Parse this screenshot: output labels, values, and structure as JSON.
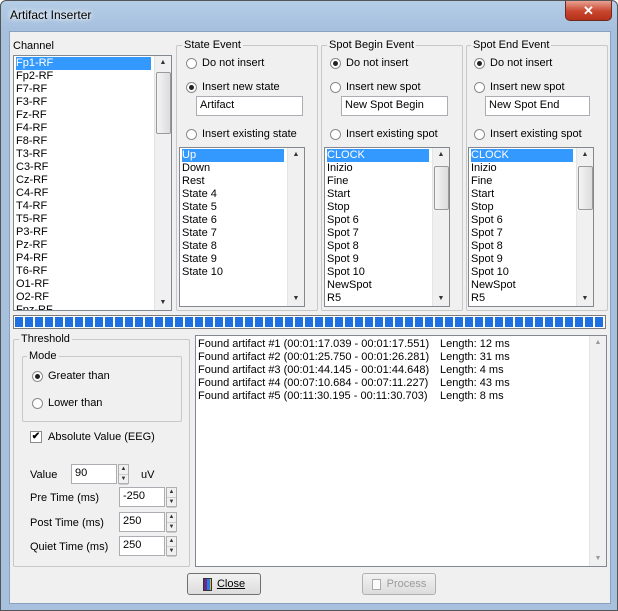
{
  "window": {
    "title": "Artifact Inserter",
    "close_glyph": "✕"
  },
  "channel": {
    "label": "Channel",
    "items": [
      "Fp1-RF",
      "Fp2-RF",
      "F7-RF",
      "F3-RF",
      "Fz-RF",
      "F4-RF",
      "F8-RF",
      "T3-RF",
      "C3-RF",
      "Cz-RF",
      "C4-RF",
      "T4-RF",
      "T5-RF",
      "P3-RF",
      "Pz-RF",
      "P4-RF",
      "T6-RF",
      "O1-RF",
      "O2-RF",
      "Fpz-RF"
    ],
    "selected": "Fp1-RF"
  },
  "state_event": {
    "label": "State Event",
    "do_not_insert": "Do not insert",
    "insert_new": "Insert new state",
    "new_value": "Artifact",
    "insert_existing": "Insert existing state",
    "items": [
      "Up",
      "Down",
      "Rest",
      "State 4",
      "State 5",
      "State 6",
      "State 7",
      "State 8",
      "State 9",
      "State 10"
    ],
    "selected": "Up",
    "active_option": "insert_new"
  },
  "spot_begin": {
    "label": "Spot Begin Event",
    "do_not_insert": "Do not insert",
    "insert_new": "Insert new spot",
    "new_value": "New Spot Begin",
    "insert_existing": "Insert existing spot",
    "items": [
      "CLOCK",
      "Inizio",
      "Fine",
      "Start",
      "Stop",
      "Spot 6",
      "Spot 7",
      "Spot 8",
      "Spot 9",
      "Spot 10",
      "NewSpot",
      "R5"
    ],
    "selected": "CLOCK",
    "active_option": "do_not_insert"
  },
  "spot_end": {
    "label": "Spot End Event",
    "do_not_insert": "Do not insert",
    "insert_new": "Insert new spot",
    "new_value": "New Spot End",
    "insert_existing": "Insert existing spot",
    "items": [
      "CLOCK",
      "Inizio",
      "Fine",
      "Start",
      "Stop",
      "Spot 6",
      "Spot 7",
      "Spot 8",
      "Spot 9",
      "Spot 10",
      "NewSpot",
      "R5"
    ],
    "selected": "CLOCK",
    "active_option": "do_not_insert"
  },
  "progress": {
    "value_fraction": 1.0
  },
  "threshold": {
    "label": "Threshold",
    "mode_label": "Mode",
    "greater_than": "Greater than",
    "lower_than": "Lower than",
    "mode_selected": "greater_than",
    "absolute_value_label": "Absolute Value (EEG)",
    "absolute_value_checked": true,
    "value_label": "Value",
    "value": "90",
    "value_unit": "uV",
    "pre_time_label": "Pre Time (ms)",
    "pre_time": "-250",
    "post_time_label": "Post Time (ms)",
    "post_time": "250",
    "quiet_time_label": "Quiet Time (ms)",
    "quiet_time": "250"
  },
  "log": {
    "lines": [
      {
        "text": "Found artifact #1 (00:01:17.039 - 00:01:17.551)",
        "length": "Length: 12 ms"
      },
      {
        "text": "Found artifact #2 (00:01:25.750 - 00:01:26.281)",
        "length": "Length: 31 ms"
      },
      {
        "text": "Found artifact #3 (00:01:44.145 - 00:01:44.648)",
        "length": "Length: 4 ms"
      },
      {
        "text": "Found artifact #4 (00:07:10.684 - 00:07:11.227)",
        "length": "Length: 43 ms"
      },
      {
        "text": "Found artifact #5 (00:11:30.195 - 00:11:30.703)",
        "length": "Length: 8 ms"
      }
    ]
  },
  "buttons": {
    "close": "Close",
    "process": "Process"
  }
}
